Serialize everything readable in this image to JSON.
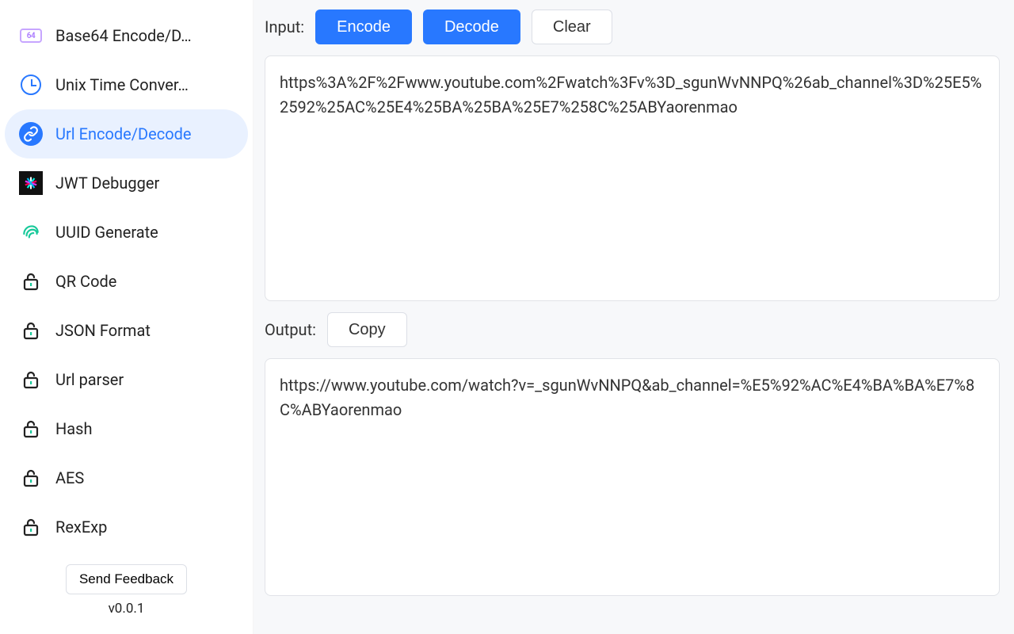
{
  "sidebar": {
    "items": [
      {
        "label": "Base64 Encode/D…"
      },
      {
        "label": "Unix Time Conver…"
      },
      {
        "label": "Url Encode/Decode"
      },
      {
        "label": "JWT Debugger"
      },
      {
        "label": "UUID Generate"
      },
      {
        "label": "QR Code"
      },
      {
        "label": "JSON Format"
      },
      {
        "label": "Url parser"
      },
      {
        "label": "Hash"
      },
      {
        "label": "AES"
      },
      {
        "label": "RexExp"
      }
    ],
    "feedback_label": "Send Feedback",
    "version": "v0.0.1"
  },
  "main": {
    "input_label": "Input:",
    "encode_label": "Encode",
    "decode_label": "Decode",
    "clear_label": "Clear",
    "output_label": "Output:",
    "copy_label": "Copy",
    "input_value": "https%3A%2F%2Fwww.youtube.com%2Fwatch%3Fv%3D_sgunWvNNPQ%26ab_channel%3D%25E5%2592%25AC%25E4%25BA%25BA%25E7%258C%25ABYaorenmao",
    "output_value": "https://www.youtube.com/watch?v=_sgunWvNNPQ&ab_channel=%E5%92%AC%E4%BA%BA%E7%8C%ABYaorenmao"
  }
}
